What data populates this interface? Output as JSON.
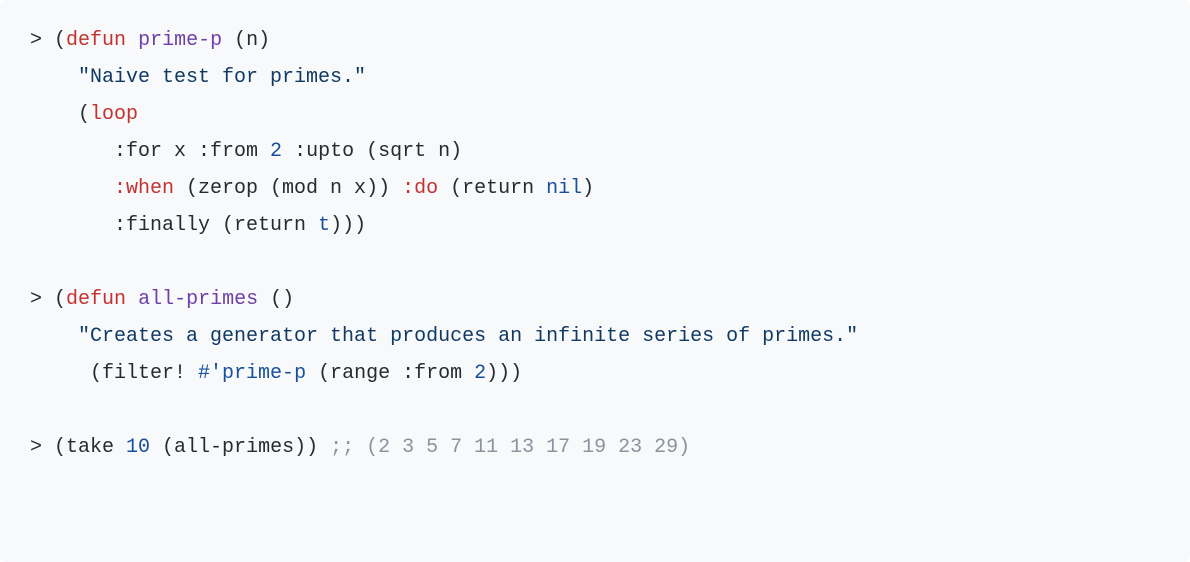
{
  "code": {
    "prompt": "> ",
    "indent4": "    ",
    "indent5": "     ",
    "indent7": "       ",
    "defun": "defun",
    "loop": "loop",
    "when_kw": ":when",
    "do_kw": ":do",
    "nil": "nil",
    "t": "t",
    "block1": {
      "fn_name": "prime-p",
      "params": " (n)",
      "docstring": "\"Naive test for primes.\"",
      "loop_line_open": "(",
      "for_line": ":for x :from ",
      "num2": "2",
      "upto": " :upto (sqrt n)",
      "when_body": " (zerop (mod n x)) ",
      "return_nil_open": " (return ",
      "return_nil_close": ")",
      "finally": ":finally (return ",
      "finally_close": ")))"
    },
    "block2": {
      "fn_name": "all-primes",
      "params": " ()",
      "docstring": "\"Creates a generator that produces an infinite series of primes.\"",
      "body_open": "(filter! ",
      "hashquote": "#'prime-p",
      "range_part": " (range :from ",
      "num2": "2",
      "body_close": ")))"
    },
    "block3": {
      "take_open": "(take ",
      "num10": "10",
      "take_rest": " (all-primes)) ",
      "comment": ";; (2 3 5 7 11 13 17 19 23 29)"
    },
    "open": "(",
    "close": ")"
  }
}
